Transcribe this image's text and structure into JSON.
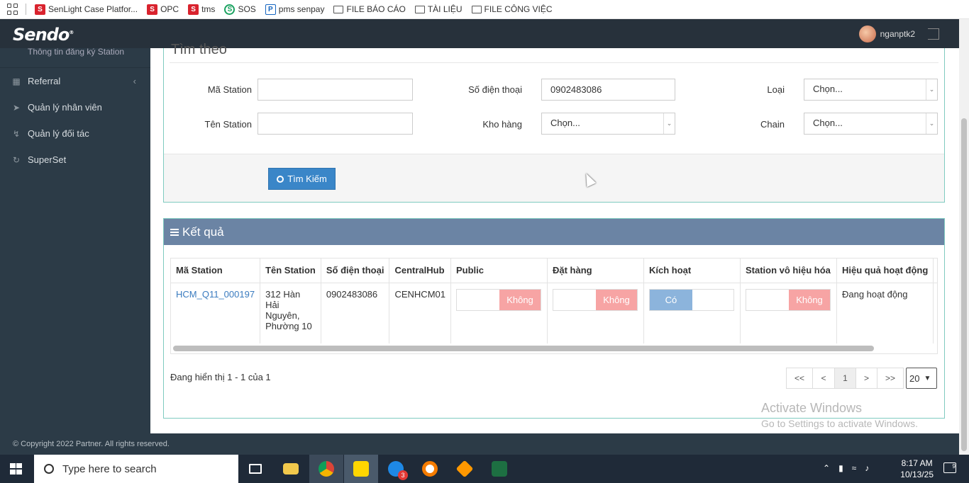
{
  "bookmarks": [
    {
      "label": "SenLight Case Platfor...",
      "icon": "senlight-icon"
    },
    {
      "label": "OPC",
      "icon": "opc-icon"
    },
    {
      "label": "tms",
      "icon": "tms-icon"
    },
    {
      "label": "SOS",
      "icon": "sos-icon"
    },
    {
      "label": "pms senpay",
      "icon": "pms-icon"
    },
    {
      "label": "FILE BÁO CÁO",
      "icon": "folder-icon"
    },
    {
      "label": "TÀI LIỆU",
      "icon": "folder-icon"
    },
    {
      "label": "FILE CÔNG VIỆC",
      "icon": "folder-icon"
    }
  ],
  "header": {
    "logo": "Sendo",
    "username": "nganptk2"
  },
  "sidebar": {
    "partial_item": "Thông tin đăng ký Station",
    "items": [
      {
        "label": "Referral",
        "icon": "gift-icon"
      },
      {
        "label": "Quản lý nhân viên",
        "icon": "rocket-icon"
      },
      {
        "label": "Quản lý đối tác",
        "icon": "bolt-icon"
      },
      {
        "label": "SuperSet",
        "icon": "history-icon"
      }
    ]
  },
  "search": {
    "title": "Tìm theo",
    "ma_station_label": "Mã Station",
    "ma_station_value": "",
    "ten_station_label": "Tên Station",
    "ten_station_value": "",
    "phone_label": "Số điện thoại",
    "phone_value": "0902483086",
    "kho_hang_label": "Kho hàng",
    "kho_hang_value": "Chọn...",
    "loai_label": "Loại",
    "loai_value": "Chọn...",
    "chain_label": "Chain",
    "chain_value": "Chọn...",
    "button_label": "Tìm Kiếm"
  },
  "results": {
    "title": "Kết quả",
    "columns": [
      "Mã Station",
      "Tên Station",
      "Số điện thoại",
      "CentralHub",
      "Public",
      "Đặt hàng",
      "Kích hoạt",
      "Station vô hiệu hóa",
      "Hiệu quả hoạt động",
      "T"
    ],
    "rows": [
      {
        "ma_station": "HCM_Q11_000197",
        "ten_station": "312 Hàn Hải Nguyên, Phường 10",
        "phone": "0902483086",
        "central_hub": "CENHCM01",
        "public": "Không",
        "dat_hang": "Không",
        "kich_hoat": "Có",
        "vo_hieu_hoa": "Không",
        "hieu_qua": "Đang hoạt động"
      }
    ],
    "summary": "Đang hiển thị 1 - 1 của 1",
    "pager": {
      "first": "<<",
      "prev": "<",
      "current": "1",
      "next": ">",
      "last": ">>",
      "page_size": "20"
    }
  },
  "watermark": {
    "line1": "Activate Windows",
    "line2": "Go to Settings to activate Windows."
  },
  "footer": "© Copyright 2022 Partner. All rights reserved.",
  "taskbar": {
    "search_placeholder": "Type here to search",
    "time": "8:17 AM",
    "date": "10/13/25",
    "zalo_badge": "3",
    "notif_count": "9"
  },
  "colors": {
    "sidebar": "#2c3b47",
    "topbar": "#27313b",
    "accent": "#3a86c8",
    "results_header": "#6b84a4",
    "toggle_off": "#f7a4a4",
    "toggle_on": "#8cb4dc"
  }
}
